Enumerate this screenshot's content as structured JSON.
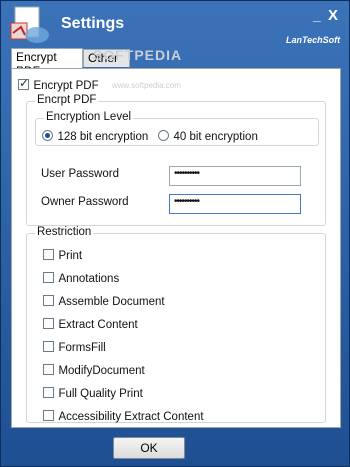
{
  "window": {
    "title": "Settings",
    "brand": "LanTechSoft",
    "min_label": "_",
    "close_label": "X"
  },
  "tabs": [
    {
      "label": "Encrypt PDF"
    },
    {
      "label": "Other"
    }
  ],
  "watermark": {
    "text": "SOFTPEDIA",
    "url": "www.softpedia.com"
  },
  "encrypt_pdf_toggle": {
    "label": "Encrypt PDF",
    "checked": true
  },
  "encrypt_group": {
    "legend": "Encrpt PDF",
    "level_group": {
      "legend": "Encryption Level",
      "options": [
        {
          "label": "128 bit encryption",
          "checked": true
        },
        {
          "label": "40 bit encryption",
          "checked": false
        }
      ]
    },
    "user_password": {
      "label": "User Password",
      "value": "••••••••••"
    },
    "owner_password": {
      "label": "Owner Password",
      "value": "••••••••••"
    }
  },
  "restriction": {
    "legend": "Restriction",
    "items": [
      {
        "label": "Print"
      },
      {
        "label": "Annotations"
      },
      {
        "label": "Assemble Document"
      },
      {
        "label": "Extract Content"
      },
      {
        "label": "FormsFill"
      },
      {
        "label": "ModifyDocument"
      },
      {
        "label": "Full Quality Print"
      },
      {
        "label": "Accessibility Extract Content"
      }
    ]
  },
  "buttons": {
    "ok": "OK"
  },
  "colors": {
    "title_bar": "#2b5fa0",
    "panel": "#ffffff"
  }
}
